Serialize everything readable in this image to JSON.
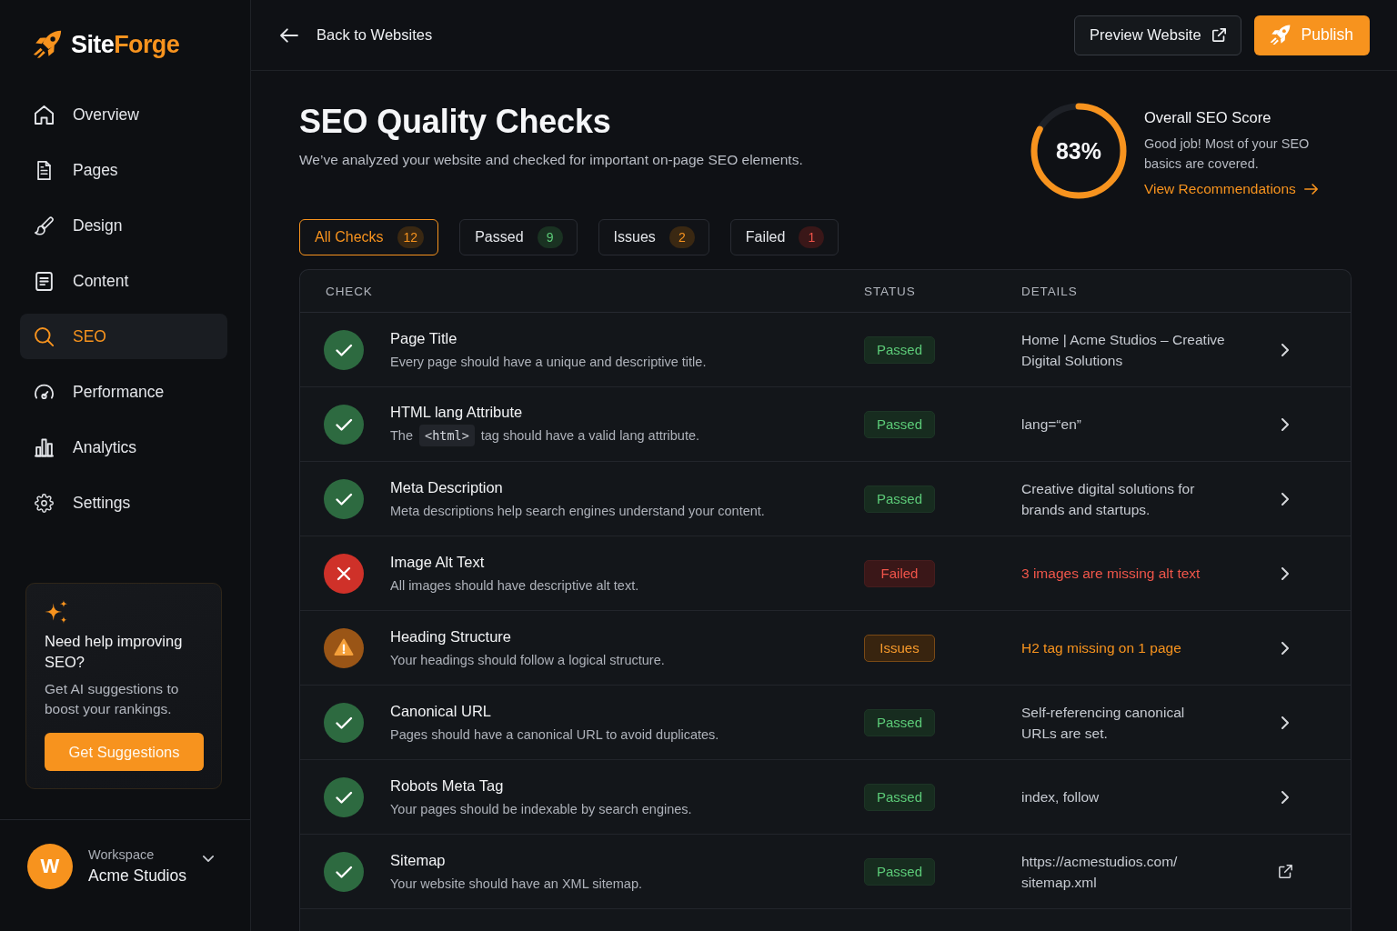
{
  "sidebar": {
    "brand": {
      "name_start": "Site",
      "name_end": "Forge"
    },
    "nav": [
      {
        "label": "Overview",
        "selected": false
      },
      {
        "label": "Pages",
        "selected": false
      },
      {
        "label": "Design",
        "selected": false
      },
      {
        "label": "Content",
        "selected": false
      },
      {
        "label": "SEO",
        "selected": true
      },
      {
        "label": "Performance",
        "selected": false
      },
      {
        "label": "Analytics",
        "selected": false
      },
      {
        "label": "Settings",
        "selected": false
      }
    ],
    "help_card": {
      "title": "Need help improving SEO?",
      "text": "Get AI suggestions to boost your rankings.",
      "button": "Get Suggestions"
    },
    "workspace": {
      "avatar": "W",
      "label": "Workspace",
      "name": "Acme Studios"
    }
  },
  "header": {
    "back": "Back to Websites",
    "preview_button": "Preview Website",
    "publish_button": "Publish"
  },
  "page": {
    "title": "SEO Quality Checks",
    "subtitle": "We’ve analyzed your website and checked for important on-page SEO elements."
  },
  "score": {
    "value": "83%",
    "level": 0.83,
    "title": "Overall SEO Score",
    "text": "Good job! Most of your SEO basics are covered.",
    "link": "View Recommendations"
  },
  "filters": [
    {
      "label": "All Checks",
      "count": "12",
      "kind": "all",
      "selected": true
    },
    {
      "label": "Passed",
      "count": "9",
      "kind": "passed",
      "selected": false
    },
    {
      "label": "Issues",
      "count": "2",
      "kind": "issues",
      "selected": false
    },
    {
      "label": "Failed",
      "count": "1",
      "kind": "failed",
      "selected": false
    }
  ],
  "table": {
    "columns": [
      "CHECK",
      "STATUS",
      "DETAILS"
    ],
    "rows": [
      {
        "kind": "passed",
        "status_label": "Passed",
        "title": "Page Title",
        "description": "Every page should have a unique and descriptive title.",
        "details": "Home | Acme Studios – Creative\nDigital Solutions",
        "external_link": false
      },
      {
        "kind": "passed",
        "status_label": "Passed",
        "title": "HTML lang Attribute",
        "description_parts": [
          {
            "kind": "text",
            "text": "The"
          },
          {
            "kind": "code",
            "text": "<html>"
          },
          {
            "kind": "text",
            "text": "tag should have a valid lang attribute."
          }
        ],
        "details": "lang=“en”",
        "external_link": false
      },
      {
        "kind": "passed",
        "status_label": "Passed",
        "title": "Meta Description",
        "description": "Meta descriptions help search engines understand your content.",
        "details": "Creative digital solutions for\nbrands and startups.",
        "external_link": false
      },
      {
        "kind": "failed",
        "status_label": "Failed",
        "title": "Image Alt Text",
        "description": "All images should have descriptive alt text.",
        "details": "3 images are missing alt text",
        "external_link": false
      },
      {
        "kind": "issues",
        "status_label": "Issues",
        "title": "Heading Structure",
        "description": "Your headings should follow a logical structure.",
        "details": "H2 tag missing on 1 page",
        "external_link": false
      },
      {
        "kind": "passed",
        "status_label": "Passed",
        "title": "Canonical URL",
        "description": "Pages should have a canonical URL to avoid duplicates.",
        "details": "Self-referencing canonical\nURLs are set.",
        "external_link": false
      },
      {
        "kind": "passed",
        "status_label": "Passed",
        "title": "Robots Meta Tag",
        "description": "Your pages should be indexable by search engines.",
        "details": "index, follow",
        "external_link": false
      },
      {
        "kind": "passed",
        "status_label": "Passed",
        "title": "Sitemap",
        "description": "Your website should have an XML sitemap.",
        "details": "https://acmestudios.com/\nsitemap.xml",
        "external_link": true
      }
    ]
  }
}
